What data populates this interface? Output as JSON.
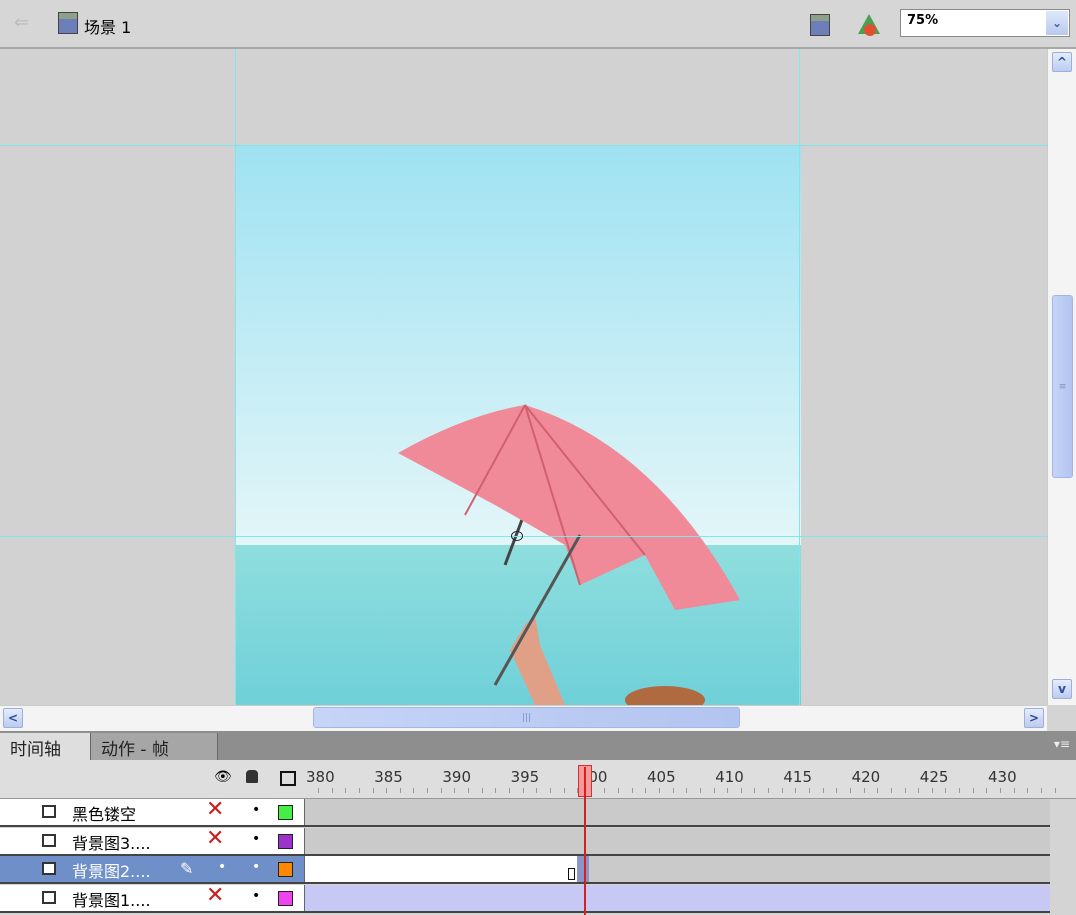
{
  "topbar": {
    "scene_label": "场景 1",
    "zoom_value": "75%",
    "icons": [
      "back-arrow-icon",
      "scene-clapper-icon",
      "edit-scene-icon",
      "edit-symbol-icon",
      "chevron-down-icon"
    ]
  },
  "timeline": {
    "tabs": [
      {
        "label": "时间轴",
        "active": true
      },
      {
        "label": "动作 - 帧",
        "active": false
      }
    ],
    "ruler": [
      380,
      385,
      390,
      395,
      400,
      405,
      410,
      415,
      420,
      425,
      430
    ],
    "current_frame": 400,
    "layers": [
      {
        "name": "黑色镂空",
        "visible": false,
        "color": "#44ee44",
        "selected": false
      },
      {
        "name": "背景图3....",
        "visible": false,
        "color": "#9933cc",
        "selected": false
      },
      {
        "name": "背景图2....",
        "visible": true,
        "color": "#ff8800",
        "selected": true
      },
      {
        "name": "背景图1....",
        "visible": false,
        "color": "#ee44ee",
        "selected": false
      }
    ]
  }
}
